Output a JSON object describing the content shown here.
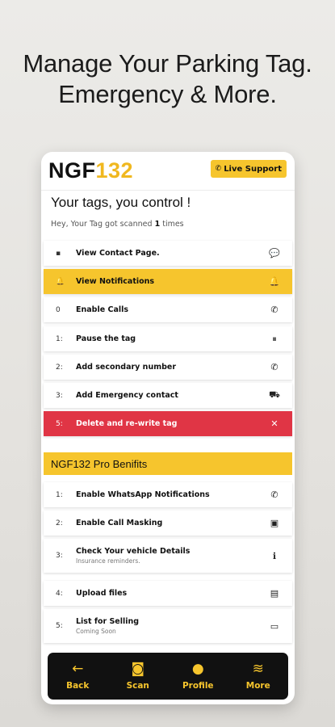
{
  "headline": [
    "Manage Your Parking Tag.",
    "Emergency & More."
  ],
  "app": {
    "brand_prefix": "NGF",
    "brand_number": "132",
    "live_support": "Live Support",
    "title": "Your tags, you control !",
    "subtitle_prefix": "Hey, Your Tag got scanned ",
    "scan_count": "1",
    "subtitle_suffix": " times"
  },
  "actions": [
    {
      "lead": "▪",
      "label": "View Contact Page.",
      "trail": "💬"
    },
    {
      "lead": "🔔",
      "label": "View Notifications",
      "trail": "🔔"
    },
    {
      "lead": "0",
      "label": "Enable Calls",
      "trail": "✆"
    },
    {
      "lead": "1:",
      "label": "Pause the tag",
      "trail": "⏸"
    },
    {
      "lead": "2:",
      "label": "Add secondary number",
      "trail": "✆"
    },
    {
      "lead": "3:",
      "label": "Add Emergency contact",
      "trail": "⛟"
    },
    {
      "lead": "5:",
      "label": "Delete and re-write tag",
      "trail": "✕"
    }
  ],
  "pro": {
    "title": "NGF132 Pro Benifits",
    "items": [
      {
        "lead": "1:",
        "label": "Enable WhatsApp Notifications",
        "sub": "",
        "trail": "✆"
      },
      {
        "lead": "2:",
        "label": "Enable Call Masking",
        "sub": "",
        "trail": "▣"
      },
      {
        "lead": "3:",
        "label": "Check Your vehicle Details",
        "sub": "Insurance reminders.",
        "trail": "ℹ"
      },
      {
        "lead": "4:",
        "label": "Upload files",
        "sub": "",
        "trail": "▤"
      },
      {
        "lead": "5:",
        "label": "List for Selling",
        "sub": "Coming Soon",
        "trail": "▭"
      }
    ]
  },
  "nav": [
    {
      "icon": "←",
      "label": "Back"
    },
    {
      "icon": "◙",
      "label": "Scan"
    },
    {
      "icon": "●",
      "label": "Profile"
    },
    {
      "icon": "≋",
      "label": "More"
    }
  ],
  "colors": {
    "accent": "#f6c52d",
    "danger": "#e03545",
    "dark": "#111111"
  }
}
